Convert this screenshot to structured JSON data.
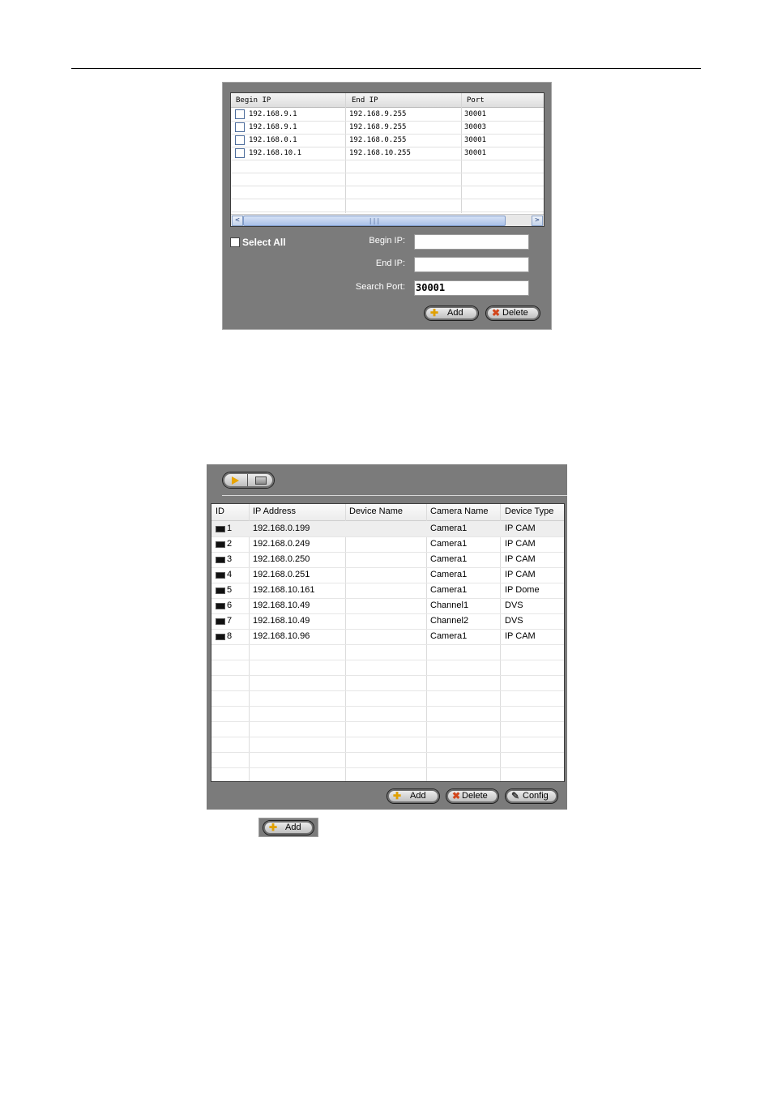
{
  "panel1": {
    "columns": [
      "Begin IP",
      "End IP",
      "Port"
    ],
    "rows": [
      {
        "begin": "192.168.9.1",
        "end": "192.168.9.255",
        "port": "30001"
      },
      {
        "begin": "192.168.9.1",
        "end": "192.168.9.255",
        "port": "30003"
      },
      {
        "begin": "192.168.0.1",
        "end": "192.168.0.255",
        "port": "30001"
      },
      {
        "begin": "192.168.10.1",
        "end": "192.168.10.255",
        "port": "30001"
      }
    ],
    "scroll_left": "<",
    "scroll_right": ">",
    "scroll_grip": "|||",
    "select_all": "Select All",
    "begin_ip_label": "Begin IP:",
    "end_ip_label": "End IP:",
    "search_port_label": "Search Port:",
    "begin_ip_value": "",
    "end_ip_value": "",
    "search_port_value": "30001",
    "add_label": "Add",
    "delete_label": "Delete"
  },
  "panel2": {
    "columns": [
      "ID",
      "IP Address",
      "Device Name",
      "Camera Name",
      "Device Type"
    ],
    "rows": [
      {
        "id": "1",
        "ip": "192.168.0.199",
        "device": "",
        "camera": "Camera1",
        "type": "IP CAM"
      },
      {
        "id": "2",
        "ip": "192.168.0.249",
        "device": "",
        "camera": "Camera1",
        "type": "IP CAM"
      },
      {
        "id": "3",
        "ip": "192.168.0.250",
        "device": "",
        "camera": "Camera1",
        "type": "IP CAM"
      },
      {
        "id": "4",
        "ip": "192.168.0.251",
        "device": "",
        "camera": "Camera1",
        "type": "IP CAM"
      },
      {
        "id": "5",
        "ip": "192.168.10.161",
        "device": "",
        "camera": "Camera1",
        "type": "IP Dome"
      },
      {
        "id": "6",
        "ip": "192.168.10.49",
        "device": "",
        "camera": "Channel1",
        "type": "DVS"
      },
      {
        "id": "7",
        "ip": "192.168.10.49",
        "device": "",
        "camera": "Channel2",
        "type": "DVS"
      },
      {
        "id": "8",
        "ip": "192.168.10.96",
        "device": "",
        "camera": "Camera1",
        "type": "IP CAM"
      }
    ],
    "add_label": "Add",
    "delete_label": "Delete",
    "config_label": "Config"
  },
  "standalone_add_label": "Add"
}
